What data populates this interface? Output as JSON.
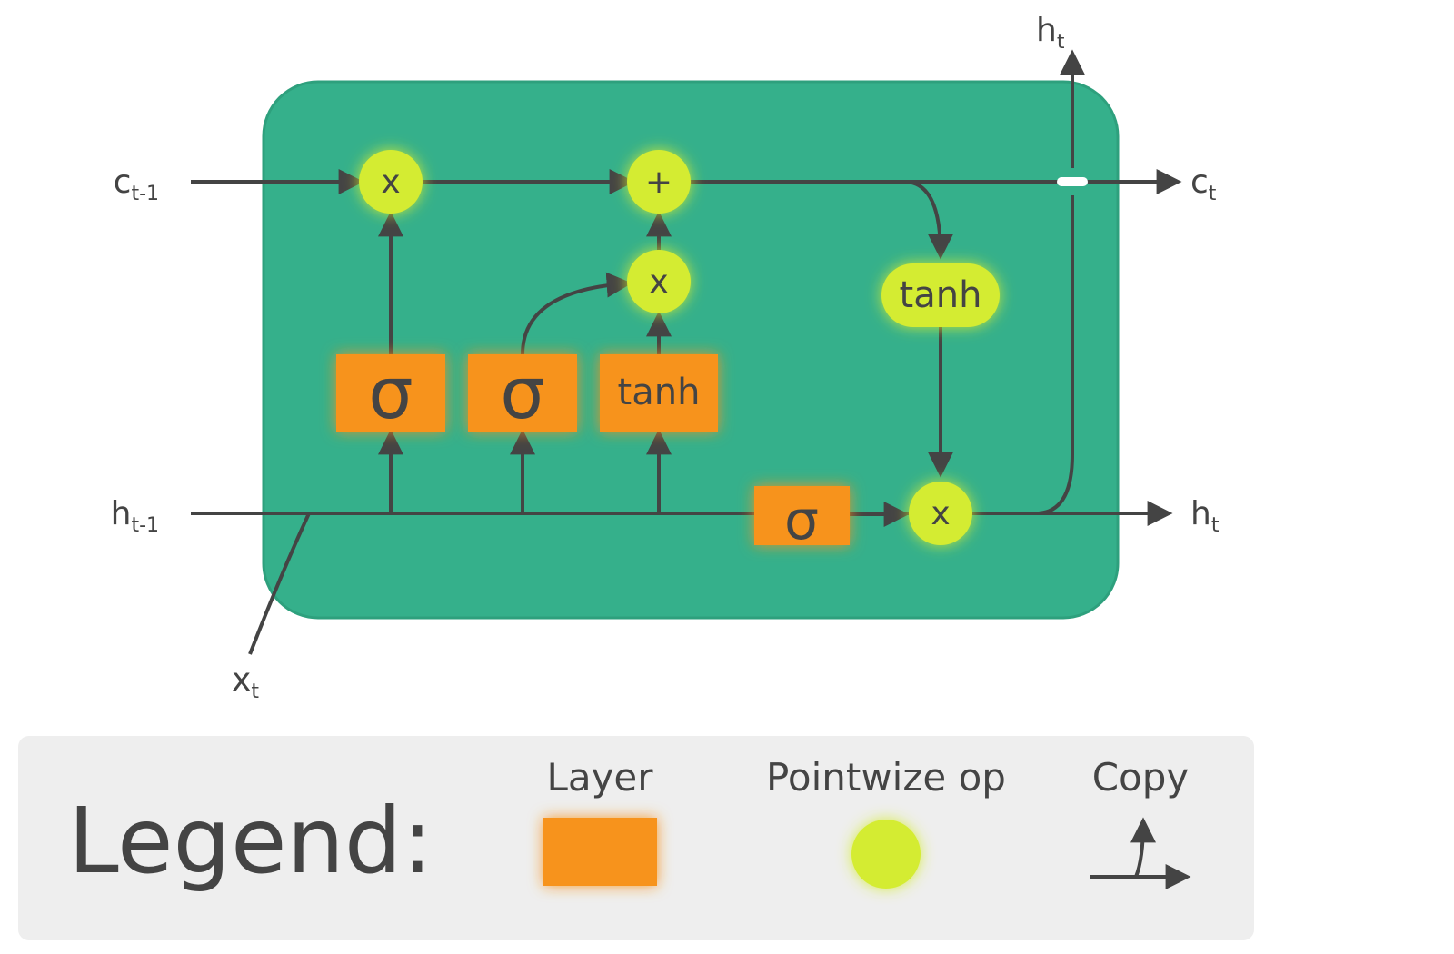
{
  "io": {
    "c_prev": "c",
    "c_prev_sub": "t-1",
    "h_prev": "h",
    "h_prev_sub": "t-1",
    "x_t": "x",
    "x_t_sub": "t",
    "c_t": "c",
    "c_t_sub": "t",
    "h_t_bottom": "h",
    "h_t_bottom_sub": "t",
    "h_t_top": "h",
    "h_t_top_sub": "t"
  },
  "layers": {
    "sigma1": "σ",
    "sigma2": "σ",
    "tanh": "tanh",
    "sigma3": "σ"
  },
  "ops": {
    "mul1": "x",
    "add": "+",
    "mul2": "x",
    "tanh": "tanh",
    "mul3": "x"
  },
  "legend": {
    "title": "Legend:",
    "layer_label": "Layer",
    "pointwise_label": "Pointwize op",
    "copy_label": "Copy"
  },
  "colors": {
    "cell_bg": "#35b08b",
    "layer": "#f7931e",
    "op": "#d4ec31",
    "line": "#444444",
    "legend_bg": "#eeeeee"
  }
}
